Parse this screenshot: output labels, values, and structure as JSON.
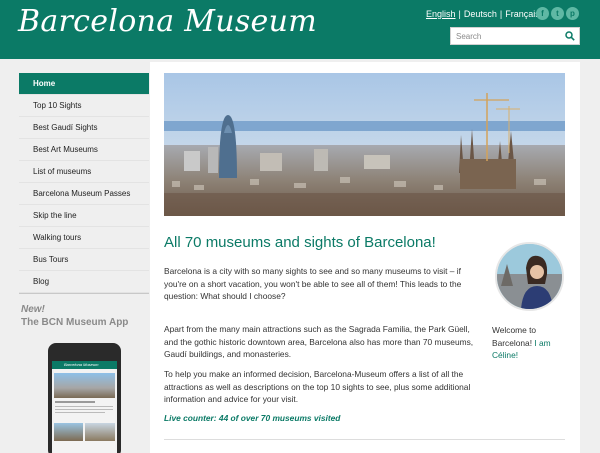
{
  "header": {
    "logo": "Barcelona Museum",
    "languages": [
      {
        "label": "English",
        "active": true
      },
      {
        "label": "Deutsch",
        "active": false
      },
      {
        "label": "Français",
        "active": false
      }
    ],
    "social": [
      {
        "icon": "facebook-icon",
        "glyph": "f"
      },
      {
        "icon": "twitter-icon",
        "glyph": "t"
      },
      {
        "icon": "pinterest-icon",
        "glyph": "p"
      }
    ],
    "search": {
      "placeholder": "Search"
    }
  },
  "sidebar": {
    "items": [
      {
        "label": "Home",
        "active": true
      },
      {
        "label": "Top 10 Sights"
      },
      {
        "label": "Best Gaudí Sights"
      },
      {
        "label": "Best Art Museums"
      },
      {
        "label": "List of museums"
      },
      {
        "label": "Barcelona Museum Passes"
      },
      {
        "label": "Skip the line"
      },
      {
        "label": "Walking tours"
      },
      {
        "label": "Bus Tours"
      },
      {
        "label": "Blog"
      }
    ],
    "app_new": "New!",
    "app_title": "The BCN Museum App"
  },
  "main": {
    "headline": "All 70 museums and sights of Barcelona!",
    "paragraphs": [
      "Barcelona is a city with so many sights to see and so many museums to visit – if you're on a short vacation, you won't be able to see all of them! This leads to the question: What should I choose?",
      "Apart from the many main attractions such as the Sagrada Familia, the Park Güell, and the gothic historic downtown area, Barcelona also has more than 70 museums, Gaudí buildings, and monasteries.",
      "To help you make an informed decision, Barcelona-Museum offers a list of all the attractions as well as descriptions on the top 10 sights to see, plus some additional information and advice for your visit."
    ],
    "counter": "Live counter: 44 of over 70 museums visited",
    "welcome_prefix": "Welcome to Barcelona! ",
    "welcome_highlight": "I am Céline!"
  },
  "colors": {
    "brand": "#0b7a66",
    "background": "#efefef"
  }
}
